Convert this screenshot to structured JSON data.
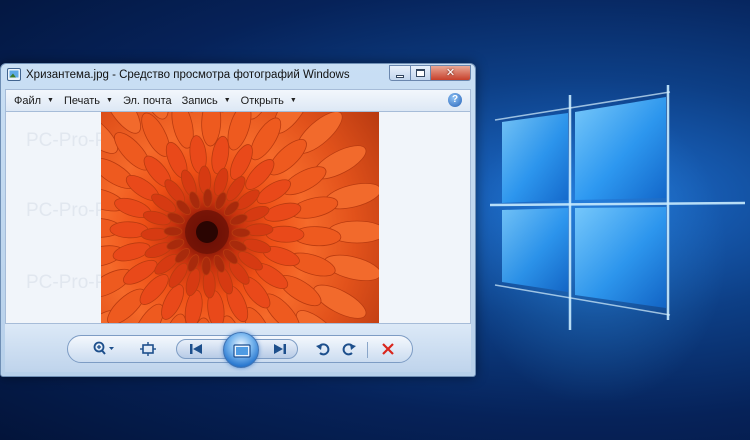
{
  "window": {
    "title": "Хризантема.jpg - Средство просмотра фотографий Windows"
  },
  "menu": {
    "items": [
      {
        "label": "Файл",
        "has_dropdown": true
      },
      {
        "label": "Печать",
        "has_dropdown": true
      },
      {
        "label": "Эл. почта",
        "has_dropdown": false
      },
      {
        "label": "Запись",
        "has_dropdown": true
      },
      {
        "label": "Открыть",
        "has_dropdown": true
      }
    ],
    "help_glyph": "?"
  },
  "viewer": {
    "watermark": "PC-Pro-Programs.RU"
  },
  "toolbar": {
    "buttons": [
      "zoom-icon",
      "fit-window-icon",
      "previous-icon",
      "slideshow-icon",
      "next-icon",
      "rotate-ccw-icon",
      "rotate-cw-icon",
      "delete-icon"
    ]
  },
  "colors": {
    "accent": "#2a78cf",
    "delete": "#d9261c",
    "desktop": "#0d3f86"
  }
}
